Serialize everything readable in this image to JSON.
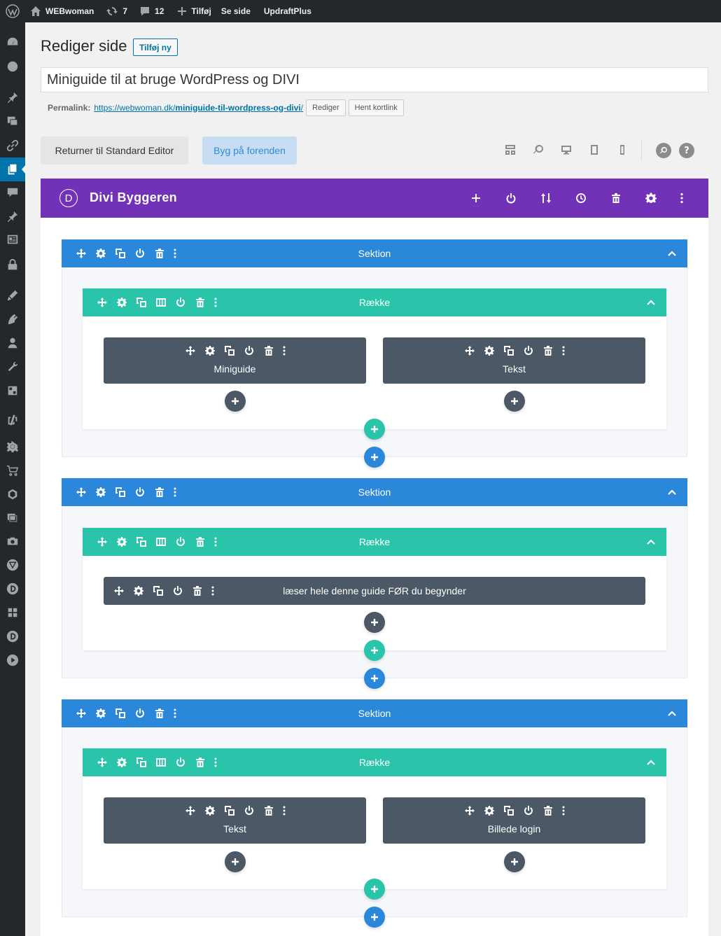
{
  "adminbar": {
    "site_name": "WEBwoman",
    "updates_count": "7",
    "comments_count": "12",
    "add_new": "Tilføj",
    "view_page": "Se side",
    "plugin": "UpdraftPlus"
  },
  "header": {
    "title": "Rediger side",
    "add_new_label": "Tilføj ny"
  },
  "post": {
    "title": "Miniguide til at bruge WordPress og DIVI",
    "permalink_label": "Permalink:",
    "permalink_base": "https://webwoman.dk/",
    "permalink_slug": "miniguide-til-wordpress-og-divi",
    "permalink_trailing": "/",
    "edit_label": "Rediger",
    "shortlink_label": "Hent kortlink"
  },
  "editor_buttons": {
    "standard_editor": "Returner til Standard Editor",
    "frontend": "Byg på forenden"
  },
  "builder": {
    "title": "Divi Byggeren",
    "logo_letter": "D",
    "help": "?"
  },
  "sections": [
    {
      "label": "Sektion",
      "rows": [
        {
          "label": "Række",
          "modules": [
            "Miniguide",
            "Tekst"
          ]
        }
      ]
    },
    {
      "label": "Sektion",
      "rows": [
        {
          "label": "Række",
          "modules": [
            "læser hele denne guide FØR du begynder"
          ]
        }
      ]
    },
    {
      "label": "Sektion",
      "rows": [
        {
          "label": "Række",
          "modules": [
            "Tekst",
            "Billede login"
          ]
        }
      ]
    }
  ],
  "colors": {
    "admin_bar": "#23282d",
    "divi_purple": "#7132b8",
    "section_blue": "#2b87da",
    "row_green": "#29c4a9",
    "module_gray": "#4c5866",
    "wp_blue": "#0073aa"
  }
}
